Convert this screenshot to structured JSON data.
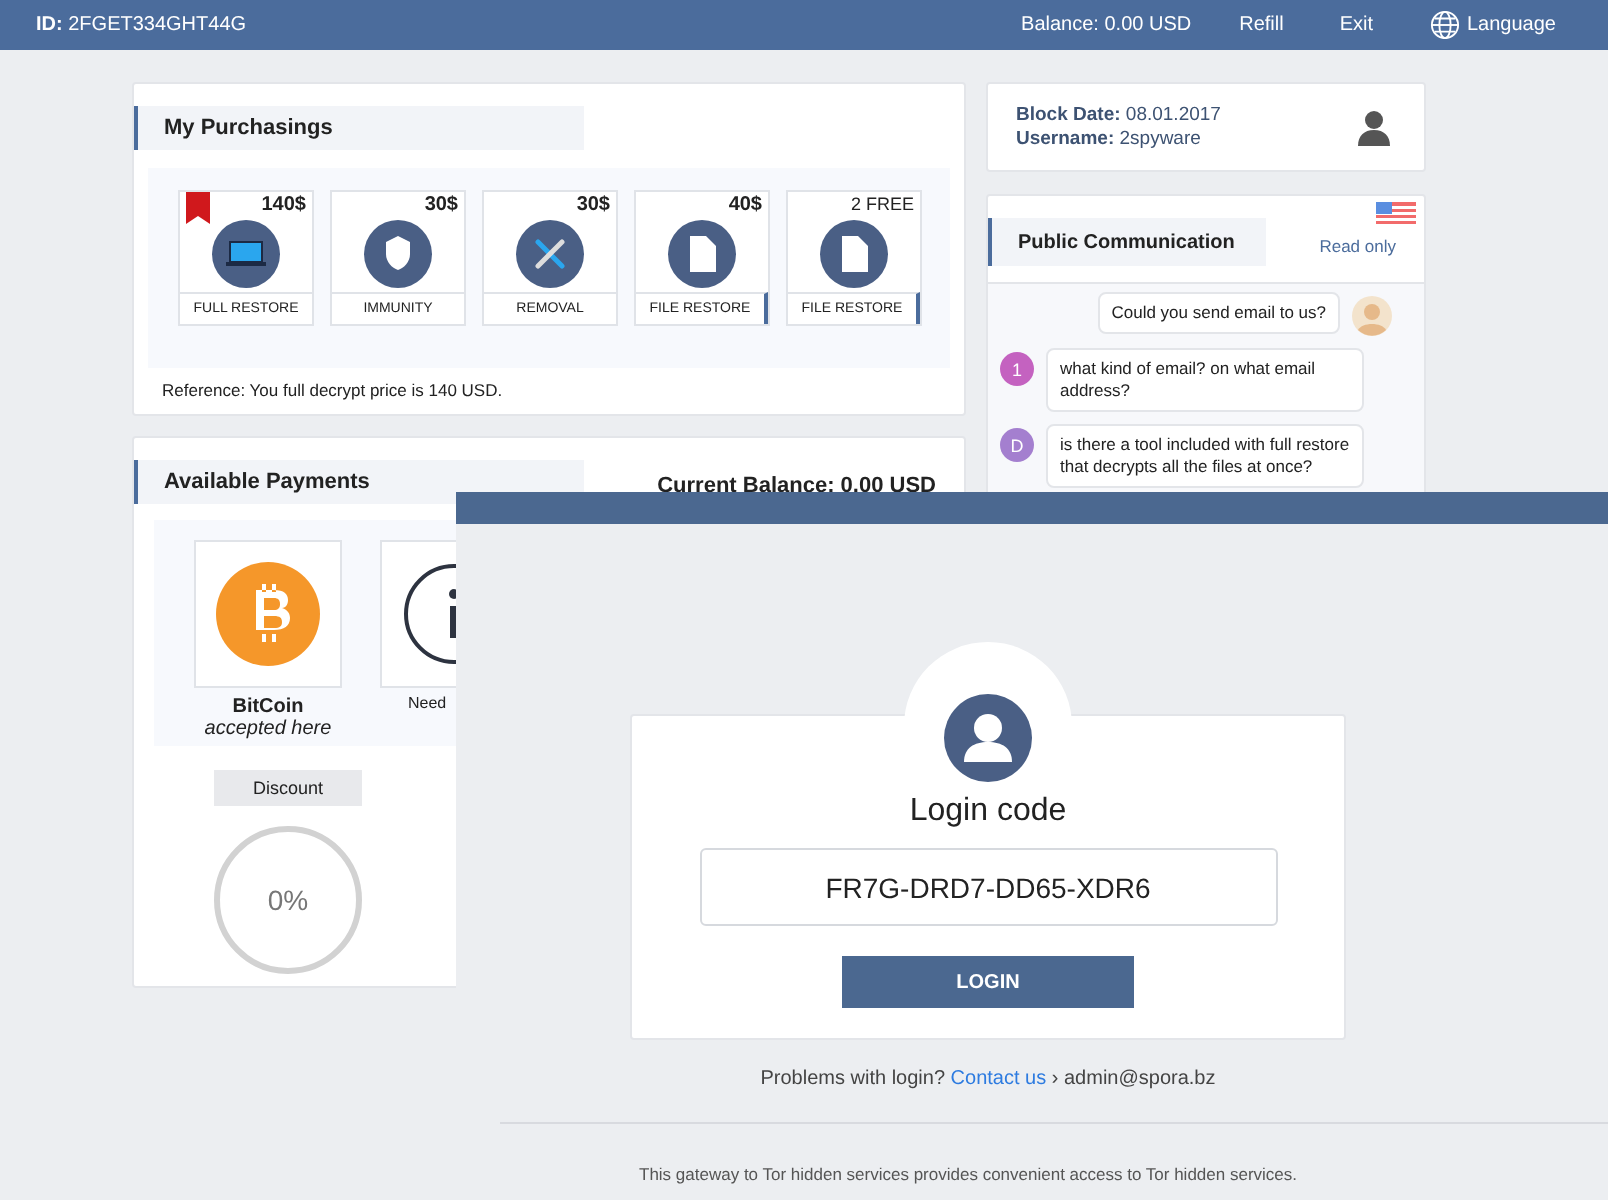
{
  "header": {
    "id_label": "ID:",
    "id": "2FGET334GHT44G",
    "balance": "Balance: 0.00 USD",
    "links": [
      "Refill",
      "Exit"
    ],
    "language": "Language"
  },
  "purchasings": {
    "title": "My Purchasings",
    "products": [
      {
        "price": "140$",
        "kind": "laptop",
        "label": "FULL RESTORE",
        "bookmarked": true,
        "selected": false
      },
      {
        "price": "30$",
        "kind": "shield",
        "label": "IMMUNITY",
        "bookmarked": false,
        "selected": false
      },
      {
        "price": "30$",
        "kind": "tools",
        "label": "REMOVAL",
        "bookmarked": false,
        "selected": false
      },
      {
        "price": "40$",
        "kind": "file",
        "label": "FILE RESTORE",
        "bookmarked": false,
        "selected": true
      },
      {
        "price": "2 FREE",
        "kind": "file",
        "label": "FILE RESTORE",
        "bookmarked": false,
        "selected": true
      }
    ],
    "reference": "Reference: You full decrypt price is 140 USD."
  },
  "payments": {
    "title": "Available Payments",
    "current_balance": "Current Balance: 0.00 USD",
    "methods": [
      {
        "kind": "bitcoin",
        "name": "BitCoin",
        "note": "accepted here"
      },
      {
        "kind": "info",
        "name": "Need"
      }
    ],
    "discount_label": "Discount",
    "discount": "0%"
  },
  "user": {
    "block_date_label": "Block Date:",
    "block_date": "08.01.2017",
    "username_label": "Username:",
    "username": "2spyware"
  },
  "communication": {
    "title": "Public Communication",
    "mode": "Read only",
    "messages": [
      {
        "kind": "outgoing",
        "text": "Could you send email to us?"
      },
      {
        "kind": "incoming",
        "avatar": "1",
        "color": "#c462c0",
        "text": "what kind of email? on what email address?"
      },
      {
        "kind": "incoming",
        "avatar": "D",
        "color": "#a47fcf",
        "text": "is there a tool included with full restore that decrypts all the files at once?"
      }
    ]
  },
  "login": {
    "title": "Login code",
    "code": "FR7G-DRD7-DD65-XDR6",
    "button": "LOGIN",
    "help": "Problems with login?",
    "contact": "Contact us",
    "separator": "›",
    "email": "admin@spora.bz",
    "footer": "This gateway to Tor hidden services provides convenient access to Tor hidden services."
  }
}
